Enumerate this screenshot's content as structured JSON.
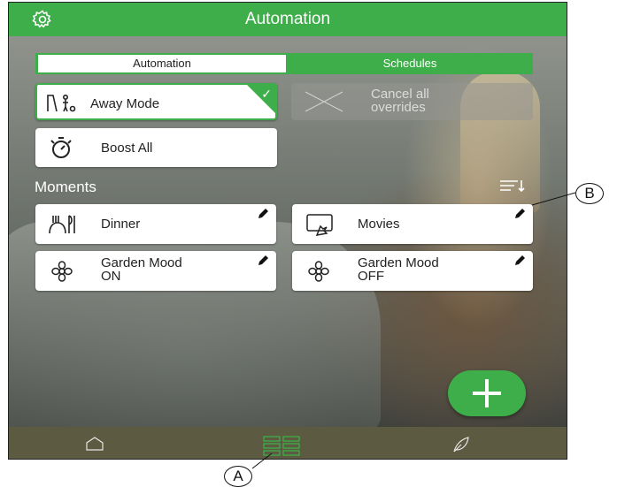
{
  "header": {
    "title": "Automation",
    "settings_icon": "gear-icon"
  },
  "tabs": [
    {
      "label": "Automation",
      "active": true
    },
    {
      "label": "Schedules",
      "active": false
    }
  ],
  "actions": {
    "away_mode": {
      "label": "Away Mode",
      "icon": "away-person-icon",
      "checked": true
    },
    "cancel_overrides": {
      "line1": "Cancel all",
      "line2": "overrides",
      "icon": "cross-icon",
      "enabled": false
    },
    "boost_all": {
      "label": "Boost All",
      "icon": "stopwatch-icon"
    }
  },
  "moments": {
    "title": "Moments",
    "sort_icon": "sort-icon",
    "items": [
      {
        "line1": "Dinner",
        "line2": "",
        "icon": "dinner-icon"
      },
      {
        "line1": "Movies",
        "line2": "",
        "icon": "movies-icon"
      },
      {
        "line1": "Garden Mood",
        "line2": "ON",
        "icon": "flower-icon"
      },
      {
        "line1": "Garden Mood",
        "line2": "OFF",
        "icon": "flower-icon"
      }
    ]
  },
  "fab": {
    "icon": "plus-icon"
  },
  "bottom_nav": [
    {
      "icon": "home-icon",
      "active": false
    },
    {
      "icon": "grid-icon",
      "active": true
    },
    {
      "icon": "leaf-icon",
      "active": false
    }
  ],
  "callouts": {
    "a": "A",
    "b": "B"
  },
  "colors": {
    "accent": "#3dae49",
    "bottom_bar": "#5c5a40"
  }
}
